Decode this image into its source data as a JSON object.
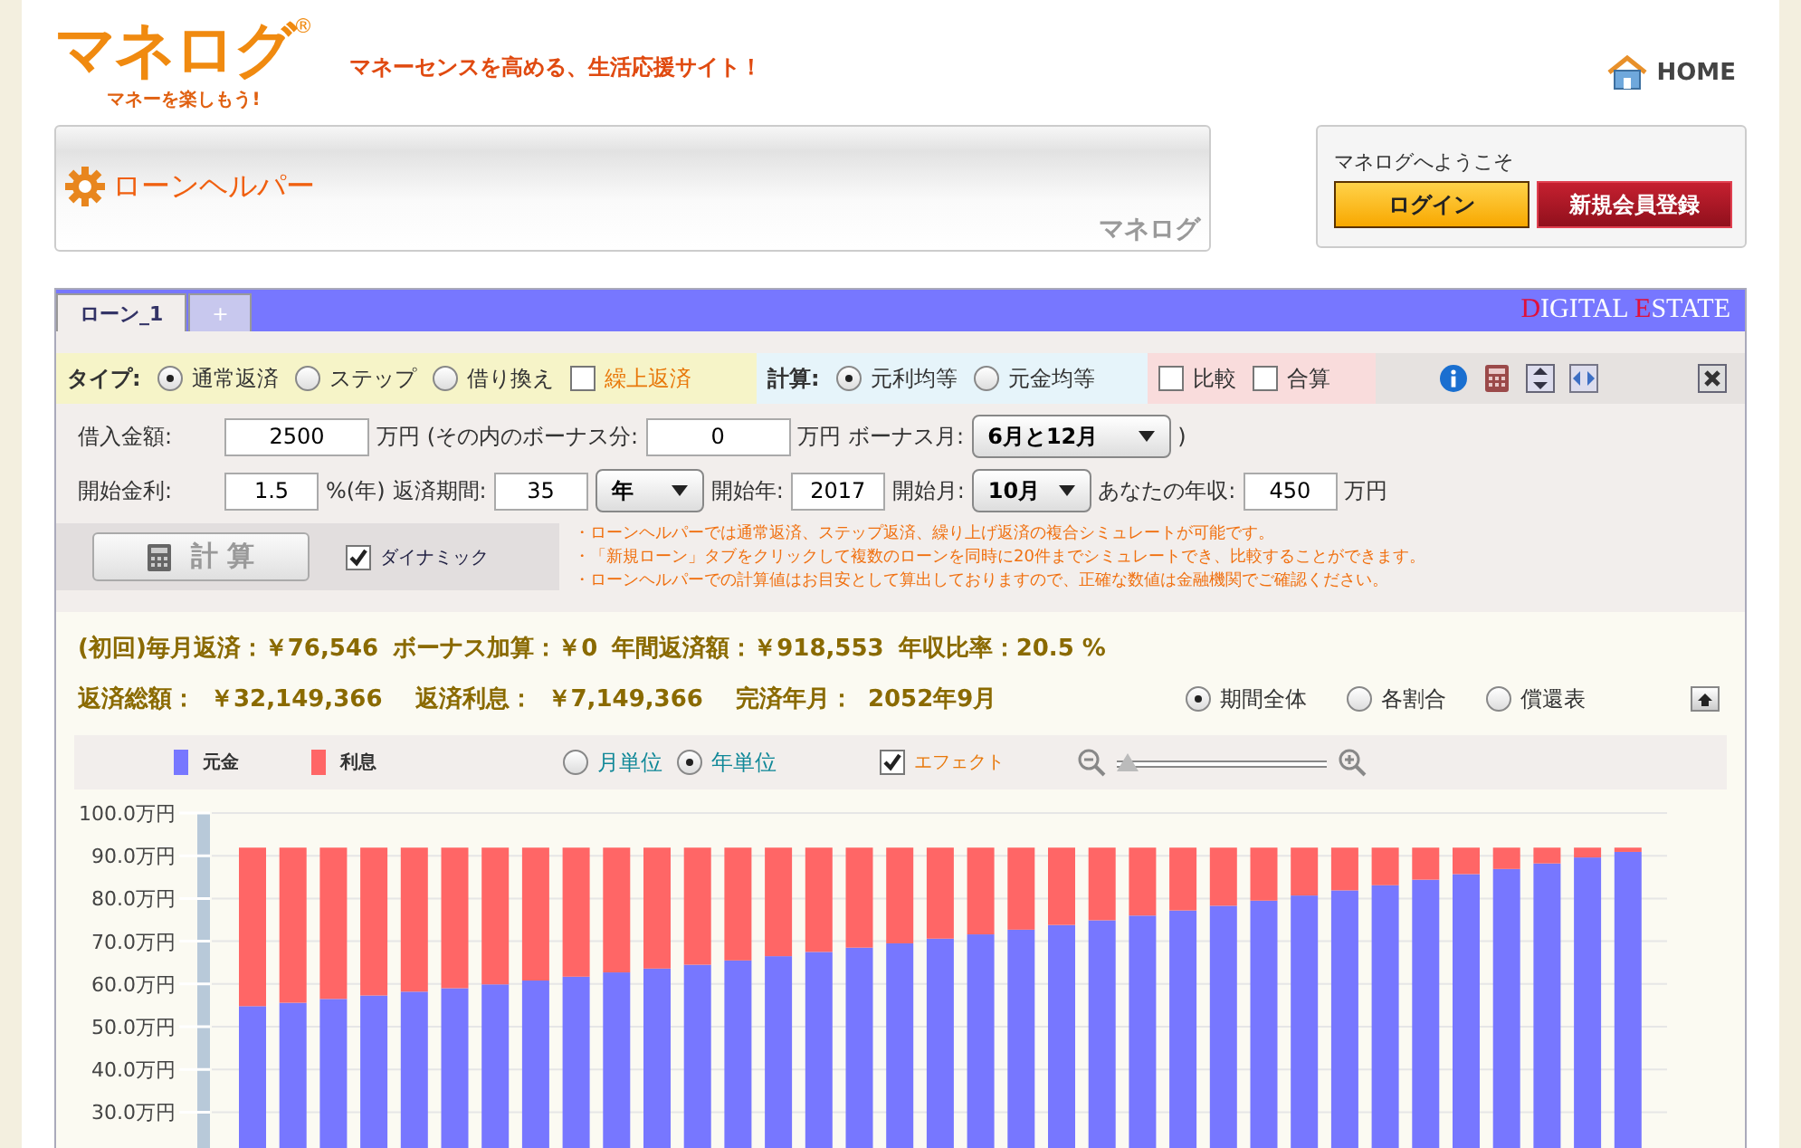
{
  "header": {
    "logo": "マネログ",
    "registered": "®",
    "logo_tagline": "マネーを楽しもう!",
    "tagline": "マネーセンスを高める、生活応援サイト！",
    "home_link": "HOME"
  },
  "title_panel": {
    "title": "ローンヘルパー",
    "brand": "マネログ"
  },
  "login_panel": {
    "welcome": "マネログへようこそ",
    "login_button": "ログイン",
    "register_button": "新規会員登録"
  },
  "tabs": [
    {
      "label": "ローン_1",
      "selected": true
    },
    {
      "label": "+",
      "selected": false
    }
  ],
  "brand_banner": "DIGITAL ESTATE",
  "type_section": {
    "label": "タイプ:",
    "options": [
      {
        "kind": "radio",
        "label": "通常返済",
        "selected": true
      },
      {
        "kind": "radio",
        "label": "ステップ",
        "selected": false
      },
      {
        "kind": "radio",
        "label": "借り換え",
        "selected": false
      },
      {
        "kind": "checkbox",
        "label": "繰上返済",
        "checked": false
      }
    ]
  },
  "calc_section": {
    "label": "計算:",
    "options": [
      {
        "label": "元利均等",
        "selected": true
      },
      {
        "label": "元金均等",
        "selected": false
      }
    ]
  },
  "compare_section": [
    {
      "label": "比較",
      "checked": false
    },
    {
      "label": "合算",
      "checked": false
    }
  ],
  "input_rows": [
    [
      {
        "kind": "label",
        "text": "借入金額:"
      },
      {
        "kind": "field",
        "value": "2500"
      },
      {
        "kind": "label",
        "text": "万円 (その内のボーナス分:"
      },
      {
        "kind": "field",
        "value": "0"
      },
      {
        "kind": "label",
        "text": "万円"
      },
      {
        "kind": "label",
        "text": "ボーナス月:"
      },
      {
        "kind": "select",
        "value": "6月と12月"
      },
      {
        "kind": "label",
        "text": ")"
      }
    ],
    [
      {
        "kind": "label",
        "text": "開始金利:"
      },
      {
        "kind": "field",
        "value": "1.5"
      },
      {
        "kind": "label",
        "text": "%(年)"
      },
      {
        "kind": "label",
        "text": "返済期間:"
      },
      {
        "kind": "field",
        "value": "35"
      },
      {
        "kind": "select",
        "value": "年"
      },
      {
        "kind": "label",
        "text": "開始年:"
      },
      {
        "kind": "field",
        "value": "2017"
      },
      {
        "kind": "label",
        "text": "開始月:"
      },
      {
        "kind": "select",
        "value": "10月"
      },
      {
        "kind": "label",
        "text": "あなたの年収:"
      },
      {
        "kind": "field",
        "value": "450"
      },
      {
        "kind": "label",
        "text": "万円"
      }
    ]
  ],
  "calc_button": "計 算",
  "dynamic": {
    "label": "ダイナミック",
    "checked": true
  },
  "notes": [
    "・ローンヘルパーでは通常返済、ステップ返済、繰り上げ返済の複合シミュレートが可能です。",
    "・「新規ローン」タブをクリックして複数のローンを同時に20件までシミュレートでき、比較することができます。",
    "・ローンヘルパーでの計算値はお目安として算出しておりますので、正確な数値は金融機関でご確認ください。"
  ],
  "summary_line1": [
    "(初回)毎月返済：￥76,546",
    "ボーナス加算：￥0",
    "年間返済額：￥918,553",
    "年収比率：20.5 %"
  ],
  "summary_line2": [
    {
      "label": "返済総額：",
      "value": "￥32,149,366"
    },
    {
      "label": "返済利息：",
      "value": "￥7,149,366"
    },
    {
      "label": "完済年月：",
      "value": "2052年9月"
    }
  ],
  "view_options": [
    {
      "label": "期間全体",
      "selected": true
    },
    {
      "label": "各割合",
      "selected": false
    },
    {
      "label": "償還表",
      "selected": false
    }
  ],
  "chart_toolbar": {
    "units": [
      {
        "label": "月単位",
        "selected": false
      },
      {
        "label": "年単位",
        "selected": true
      }
    ],
    "effect": {
      "label": "エフェクト",
      "checked": true
    },
    "zoom": {
      "level": 0
    }
  },
  "chart_data": {
    "type": "bar",
    "stacked": true,
    "grid": true,
    "ylim": [
      0,
      100
    ],
    "yticks": [
      {
        "value": 30,
        "label": "30.0万円"
      },
      {
        "value": 40,
        "label": "40.0万円"
      },
      {
        "value": 50,
        "label": "50.0万円"
      },
      {
        "value": 60,
        "label": "60.0万円"
      },
      {
        "value": 70,
        "label": "70.0万円"
      },
      {
        "value": 80,
        "label": "80.0万円"
      },
      {
        "value": 90,
        "label": "90.0万円"
      },
      {
        "value": 100,
        "label": "100.0万円"
      }
    ],
    "series": [
      {
        "name": "元金",
        "color": "#7777ff",
        "values": [
          54.8,
          55.6,
          56.5,
          57.3,
          58.2,
          59.0,
          59.9,
          60.8,
          61.7,
          62.7,
          63.6,
          64.5,
          65.5,
          66.5,
          67.5,
          68.5,
          69.5,
          70.6,
          71.6,
          72.7,
          73.8,
          74.9,
          76.0,
          77.2,
          78.3,
          79.5,
          80.7,
          81.9,
          83.1,
          84.4,
          85.7,
          86.9,
          88.2,
          89.6,
          90.9
        ]
      },
      {
        "name": "利息",
        "color": "#ff6666",
        "values": [
          37.1,
          36.3,
          35.4,
          34.6,
          33.7,
          32.9,
          32.0,
          31.1,
          30.2,
          29.2,
          28.3,
          27.4,
          26.4,
          25.4,
          24.4,
          23.4,
          22.4,
          21.3,
          20.3,
          19.2,
          18.1,
          17.0,
          15.9,
          14.7,
          13.6,
          12.4,
          11.2,
          10.0,
          8.8,
          7.5,
          6.2,
          5.0,
          3.7,
          2.3,
          1.0
        ]
      }
    ]
  }
}
